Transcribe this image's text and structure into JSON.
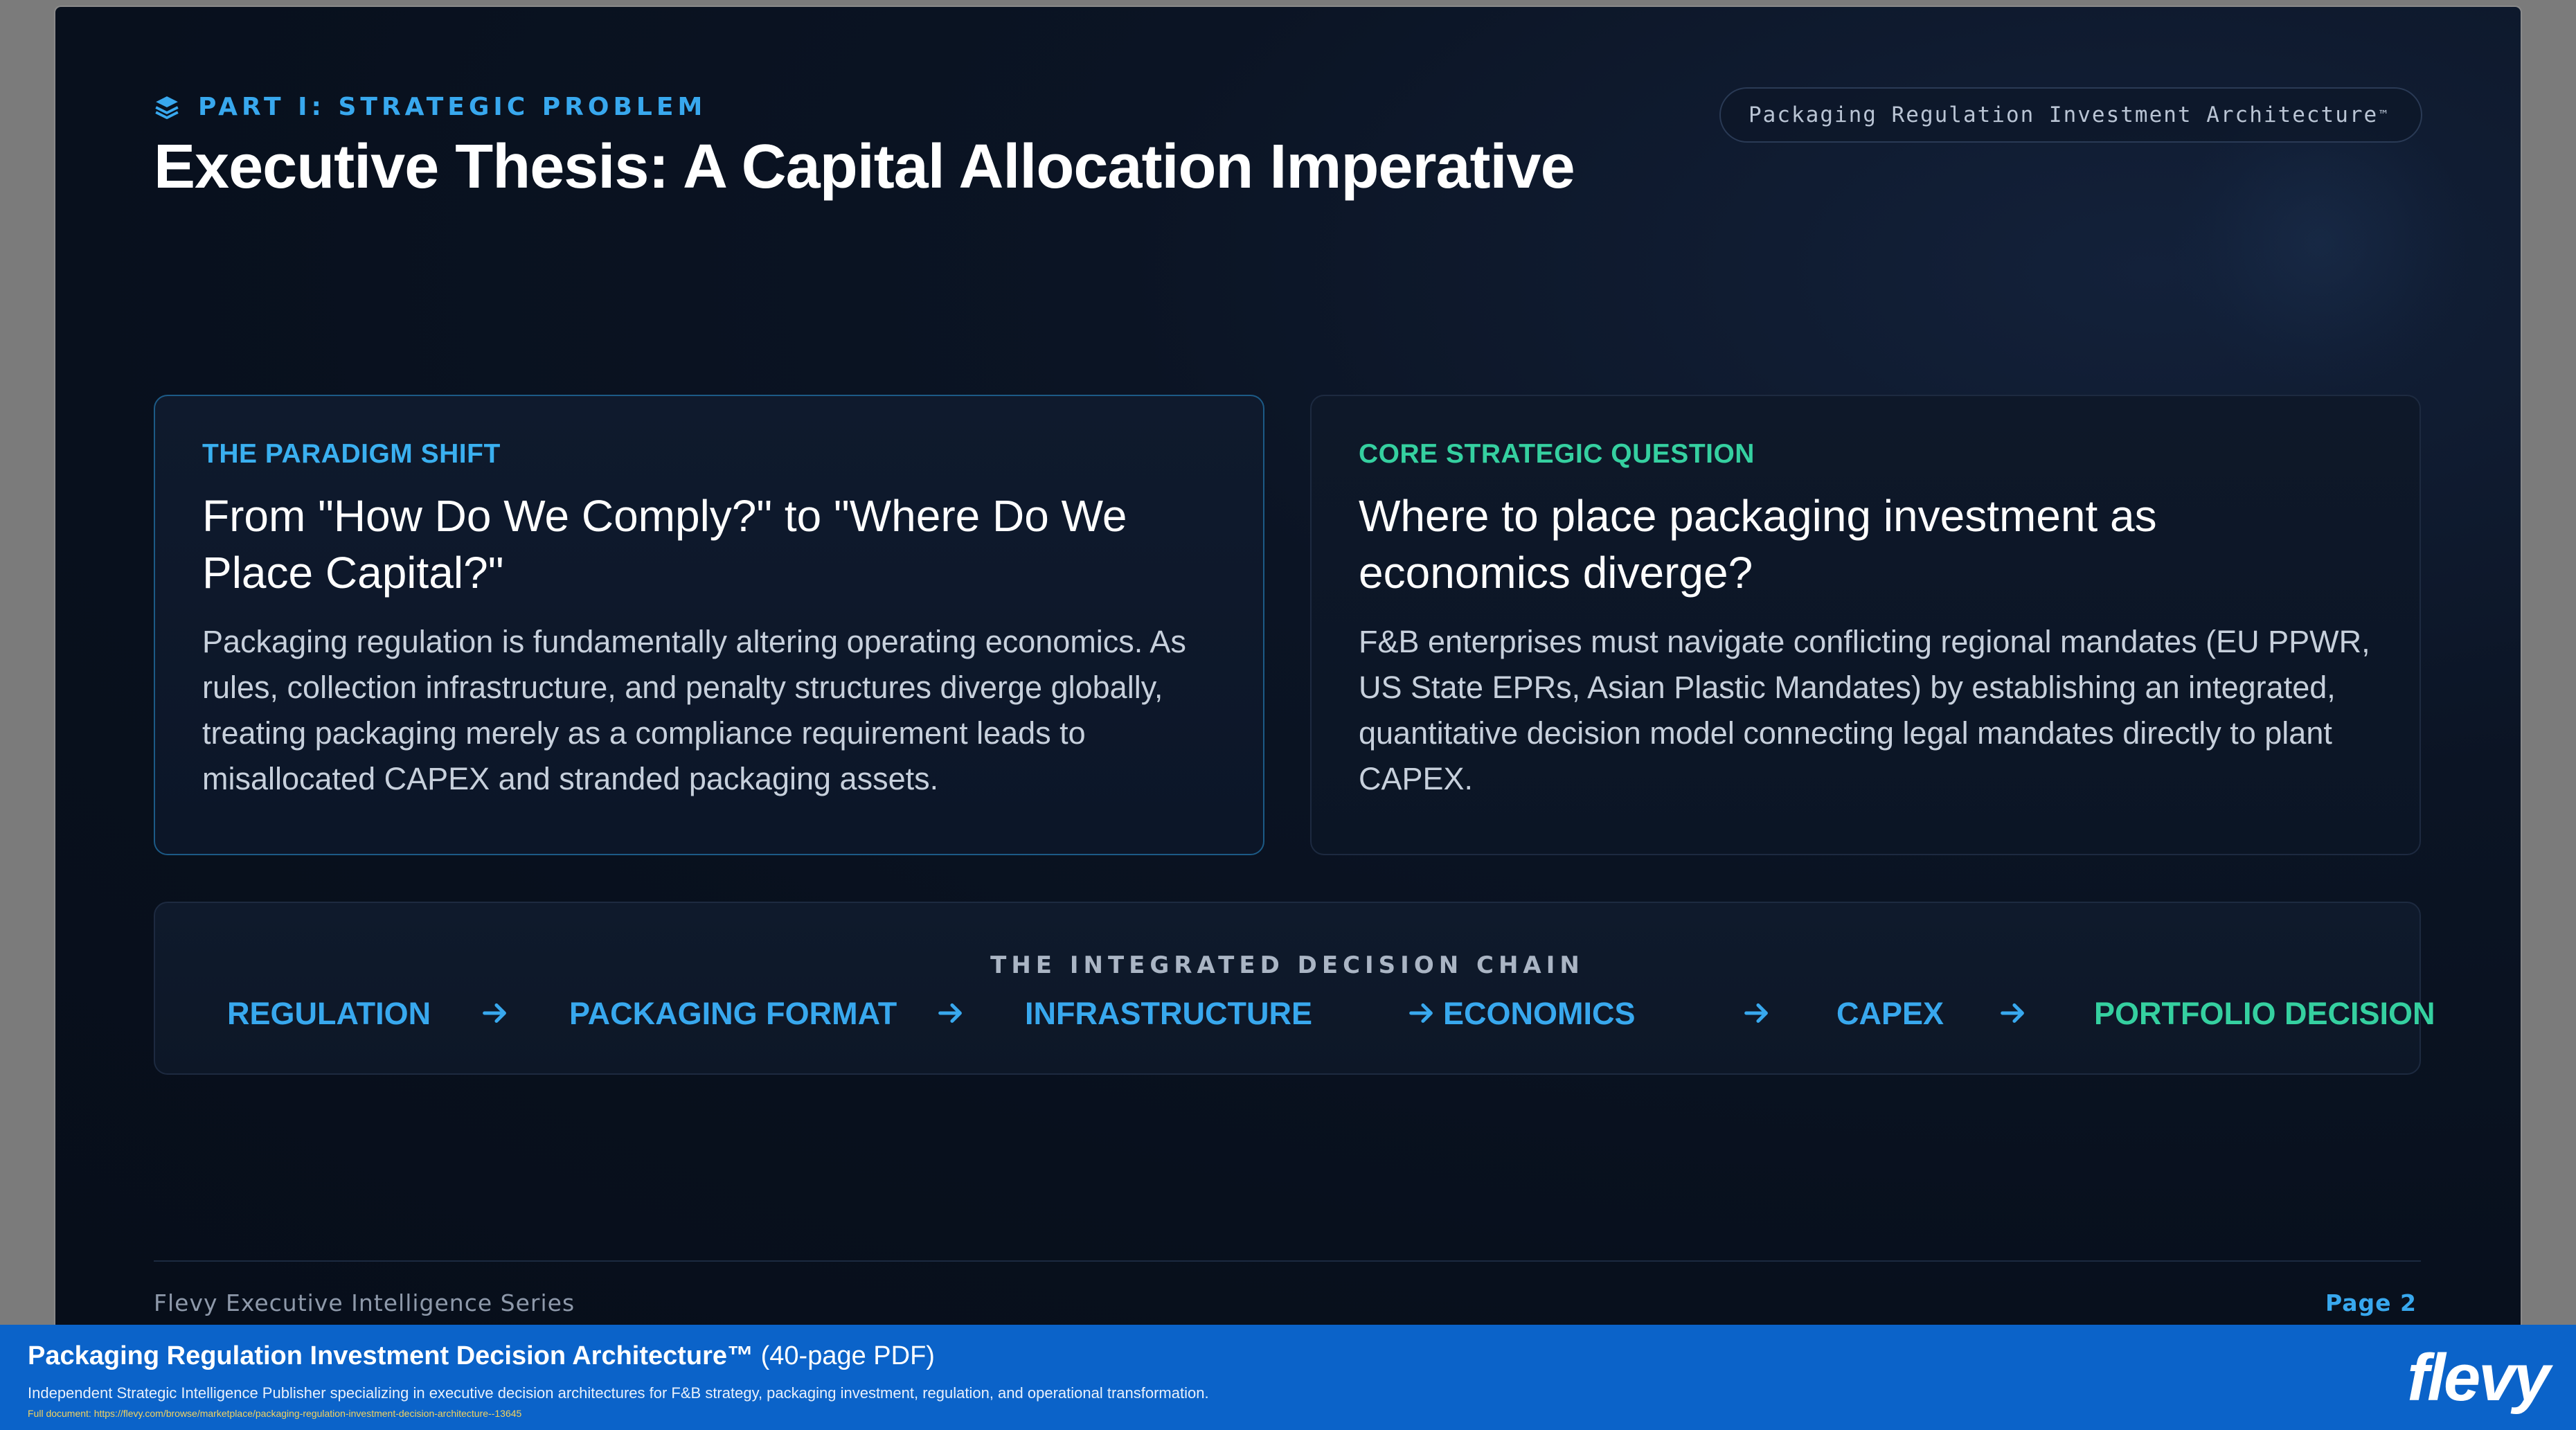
{
  "slide": {
    "part_label": "PART I: STRATEGIC PROBLEM",
    "title": "Executive Thesis: A Capital Allocation Imperative",
    "brand_pill": "Packaging Regulation Investment Architecture",
    "brand_pill_mark": "™",
    "cards": [
      {
        "eyebrow": "THE PARADIGM SHIFT",
        "heading": "From \"How Do We Comply?\" to \"Where Do We Place Capital?\"",
        "body": "Packaging regulation is fundamentally altering operating economics. As rules, collection infrastructure, and penalty structures diverge globally, treating packaging merely as a compliance requirement leads to misallocated CAPEX and stranded packaging assets."
      },
      {
        "eyebrow": "CORE STRATEGIC QUESTION",
        "heading": "Where to place packaging investment as economics diverge?",
        "body": "F&B enterprises must navigate conflicting regional mandates (EU PPWR, US State EPRs, Asian Plastic Mandates) by establishing an integrated, quantitative decision model connecting legal mandates directly to plant CAPEX."
      }
    ],
    "chain": {
      "title": "THE INTEGRATED DECISION CHAIN",
      "steps": [
        "REGULATION",
        "PACKAGING FORMAT",
        "INFRASTRUCTURE",
        "ECONOMICS",
        "CAPEX",
        "PORTFOLIO DECISION"
      ]
    },
    "footer": {
      "series": "Flevy Executive Intelligence Series",
      "page": "Page  2"
    }
  },
  "banner": {
    "doc_name": "Packaging Regulation Investment Decision Architecture™",
    "doc_pages": " (40-page PDF)",
    "description": "Independent Strategic Intelligence Publisher specializing in executive decision architectures for F&B strategy, packaging investment, regulation, and operational transformation.",
    "link": "Full document: https://flevy.com/browse/marketplace/packaging-regulation-investment-decision-architecture--13645",
    "logo": "flevy"
  },
  "colors": {
    "accent_blue": "#38a8ee",
    "accent_green": "#35d0a0",
    "banner_blue": "#0b63c9",
    "slide_bg": "#08101d"
  },
  "icons": {
    "part_label_icon": "layers-icon",
    "chain_arrow_icon": "arrow-right-icon"
  }
}
